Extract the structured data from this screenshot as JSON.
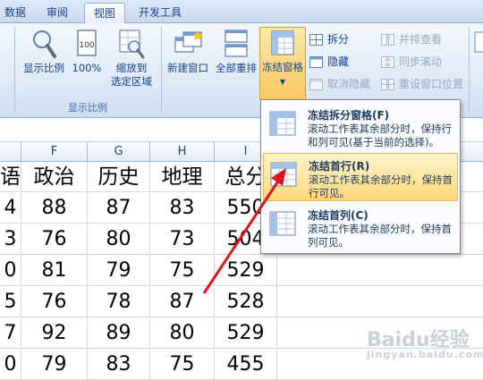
{
  "tabs": [
    {
      "label": "数据"
    },
    {
      "label": "审阅"
    },
    {
      "label": "视图"
    },
    {
      "label": "开发工具"
    }
  ],
  "ribbon": {
    "zoom_group": {
      "label": "显示比例",
      "zoom_label": "显示比例",
      "hundred_label": "100%",
      "zoom_selection_line1": "缩放到",
      "zoom_selection_line2": "选定区域"
    },
    "window_group": {
      "new_window": "新建窗口",
      "arrange_all": "全部重排",
      "freeze_panes": "冻结窗格",
      "split": "拆分",
      "hide": "隐藏",
      "unhide": "取消隐藏",
      "side_by_side": "并排查看",
      "sync_scroll": "同步滚动",
      "reset_position": "重设窗口位置"
    }
  },
  "sheet": {
    "columns": [
      "F",
      "G",
      "H",
      "I"
    ],
    "header_row": [
      "语",
      "政治",
      "历史",
      "地理",
      "总分"
    ],
    "rows": [
      [
        "4",
        "88",
        "87",
        "83",
        "550"
      ],
      [
        "3",
        "76",
        "80",
        "73",
        "504"
      ],
      [
        "0",
        "81",
        "79",
        "75",
        "529"
      ],
      [
        "5",
        "76",
        "78",
        "87",
        "528"
      ],
      [
        "7",
        "92",
        "89",
        "80",
        "529"
      ],
      [
        "0",
        "79",
        "83",
        "75",
        "455"
      ]
    ]
  },
  "freeze_menu": {
    "items": [
      {
        "title": "冻结拆分窗格(F)",
        "desc": "滚动工作表其余部分时，保持行和列可见(基于当前的选择)。"
      },
      {
        "title": "冻结首行(R)",
        "desc": "滚动工作表其余部分时，保持首行可见。"
      },
      {
        "title": "冻结首列(C)",
        "desc": "滚动工作表其余部分时，保持首列可见。"
      }
    ]
  },
  "watermark": {
    "text": "Baidu经验",
    "sub": "jingyan.baidu.com"
  },
  "colors": {
    "accent": "#15428b",
    "highlight": "#ffd77a",
    "arrow": "#e0141e"
  }
}
